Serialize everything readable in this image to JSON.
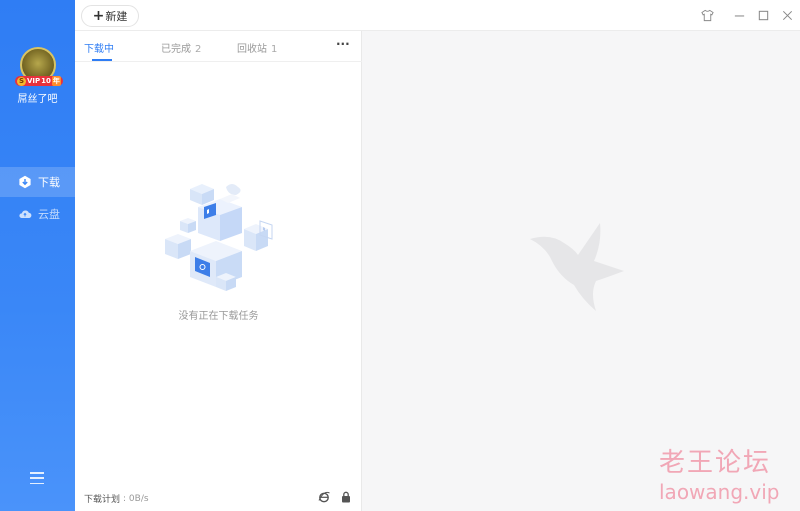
{
  "sidebar": {
    "username": "屌丝了吧",
    "vip": {
      "coin": "S",
      "level": "VIP",
      "years_label": "10",
      "year_suffix": "年"
    },
    "nav": [
      {
        "label": "下载",
        "icon": "download-hex-icon",
        "active": true
      },
      {
        "label": "云盘",
        "icon": "cloud-icon",
        "active": false
      }
    ],
    "menu_icon": "hamburger-menu-icon"
  },
  "toolbar": {
    "new_label": "新建",
    "new_icon": "plus-icon",
    "window_controls": [
      "skin-icon",
      "minimize-icon",
      "maximize-icon",
      "close-icon"
    ]
  },
  "tabs": [
    {
      "label": "下载中",
      "count": ""
    },
    {
      "label": "已完成",
      "count": "2"
    },
    {
      "label": "回收站",
      "count": "1"
    }
  ],
  "more_label": "···",
  "empty_state": {
    "text": "没有正在下载任务"
  },
  "footer": {
    "plan_label": "下载计划",
    "speed": "0B/s",
    "icons": [
      "ie-browser-icon",
      "lock-icon"
    ]
  },
  "colors": {
    "accent": "#2f7df4",
    "sidebar": "#3a87f7",
    "detail_bg": "#f6f6f7",
    "watermark": "#f1a7b6"
  },
  "watermark": {
    "cn": "老王论坛",
    "en": "laowang.vip"
  }
}
